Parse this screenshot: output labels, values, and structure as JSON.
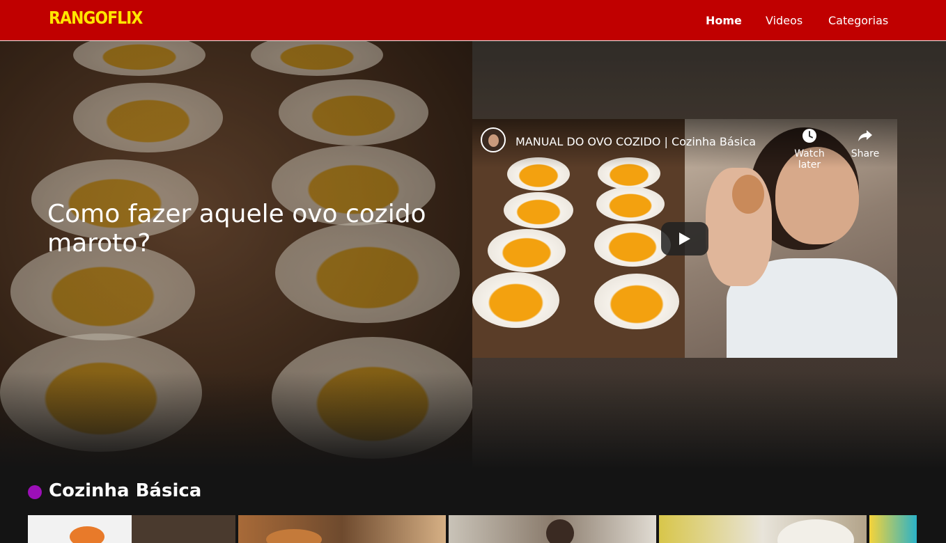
{
  "navbar": {
    "logo": "RANGOFLIX",
    "items": [
      {
        "label": "Home",
        "active": true
      },
      {
        "label": "Videos",
        "active": false
      },
      {
        "label": "Categorias",
        "active": false
      }
    ],
    "background_color": "#c00000",
    "logo_color": "#ffe600"
  },
  "hero": {
    "title": "Como fazer aquele ovo cozido maroto?",
    "video": {
      "title": "MANUAL DO OVO COZIDO | Cozinha Básica",
      "watch_later_label": "Watch later",
      "share_label": "Share",
      "icons": [
        "clock-icon",
        "share-icon",
        "play-icon"
      ]
    }
  },
  "category": {
    "title": "Cozinha Básica",
    "dot_color": "#9c0fb8",
    "thumbnails": [
      "thumb-1",
      "thumb-2",
      "thumb-3",
      "thumb-4",
      "thumb-5"
    ]
  }
}
